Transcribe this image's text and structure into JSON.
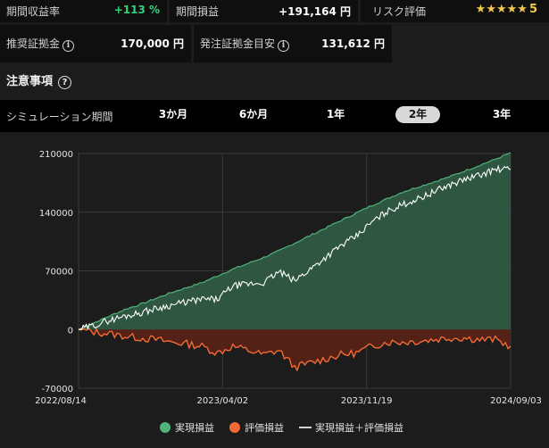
{
  "stats": {
    "return_rate": {
      "label": "期間収益率",
      "value": "+113 %"
    },
    "period_pnl": {
      "label": "期間損益",
      "value": "+191,164 円"
    },
    "risk": {
      "label": "リスク評価",
      "stars": "★★★★★",
      "score": "5"
    },
    "recommended_margin": {
      "label": "推奨証拠金",
      "value": "170,000 円"
    },
    "order_margin": {
      "label": "発注証拠金目安",
      "value": "131,612 円"
    }
  },
  "notes": {
    "label": "注意事項"
  },
  "period": {
    "label": "シミュレーション期間",
    "options": [
      "3か月",
      "6か月",
      "1年",
      "2年",
      "3年"
    ],
    "selected": "2年"
  },
  "legend": {
    "realized": "実現損益",
    "unrealized": "評価損益",
    "combined": "実現損益＋評価損益"
  },
  "colors": {
    "realized": "#4fb37a",
    "realized_fill": "#2f5a43",
    "unrealized": "#f26a35",
    "unrealized_fill": "#5a2215",
    "combined": "#ffffff"
  },
  "chart_data": {
    "type": "area",
    "x_ticks": [
      "2022/08/14",
      "2023/04/02",
      "2023/11/19",
      "2024/09/03"
    ],
    "y_ticks": [
      "210000",
      "140000",
      "70000",
      "0",
      "-70000"
    ],
    "ylim": [
      -70000,
      210000
    ],
    "grid": true,
    "series": [
      {
        "name": "実現損益",
        "values": [
          0,
          8000,
          16000,
          24000,
          30000,
          37000,
          44000,
          50000,
          56000,
          64000,
          72000,
          79000,
          86000,
          94000,
          103000,
          112000,
          121000,
          130000,
          139000,
          148000,
          156000,
          164000,
          170000,
          176000,
          182000,
          189000,
          196000,
          203000,
          211000
        ]
      },
      {
        "name": "評価損益",
        "values": [
          0,
          -3000,
          -5000,
          -8000,
          -10000,
          -12000,
          -15000,
          -17000,
          -20000,
          -28000,
          -20000,
          -25000,
          -30000,
          -25000,
          -45000,
          -40000,
          -35000,
          -30000,
          -28000,
          -20000,
          -15000,
          -15000,
          -14000,
          -12000,
          -10000,
          -10000,
          -12000,
          -12000,
          -20000
        ]
      },
      {
        "name": "実現損益＋評価損益",
        "values": [
          0,
          5000,
          11000,
          16000,
          20000,
          25000,
          29000,
          33000,
          36000,
          36000,
          52000,
          54000,
          56000,
          69000,
          58000,
          72000,
          86000,
          100000,
          111000,
          128000,
          141000,
          149000,
          156000,
          164000,
          172000,
          179000,
          184000,
          191000,
          191000
        ]
      }
    ]
  }
}
